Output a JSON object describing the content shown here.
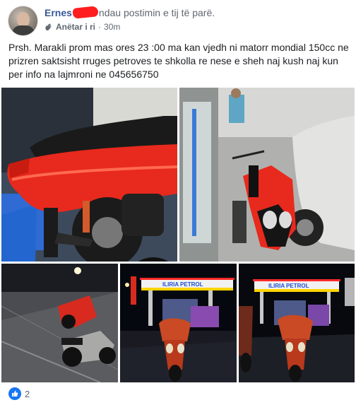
{
  "post": {
    "author": "Ernes",
    "header_suffix": "ndau postimin e tij të parë.",
    "badge": {
      "icon": "wave-hand-icon",
      "label": "Anëtar i ri"
    },
    "separator": "·",
    "time": "30m",
    "caption": "Prsh. Marakli prom mas ores 23 :00 ma kan vjedh ni matorr mondial 150cc ne prizren saktsisht rruges petroves te shkolla re nese e sheh naj kush naj kun per info na lajmroni ne 045656750",
    "photos": [
      {
        "icon": "photo-scooter-seat"
      },
      {
        "icon": "photo-scooter-garage"
      },
      {
        "icon": "photo-scooter-street"
      },
      {
        "icon": "photo-scooter-gas-station",
        "sign_text": "ILIRIA PETROL"
      },
      {
        "icon": "photo-scooter-gas-station-2",
        "sign_text": "ILIRIA PETROL"
      }
    ],
    "reactions": {
      "icon": "like-icon",
      "count": "2"
    }
  },
  "colors": {
    "author": "#385898",
    "redaction": "#ff1f1f",
    "like": "#1877f2",
    "meta_text": "#606770"
  }
}
